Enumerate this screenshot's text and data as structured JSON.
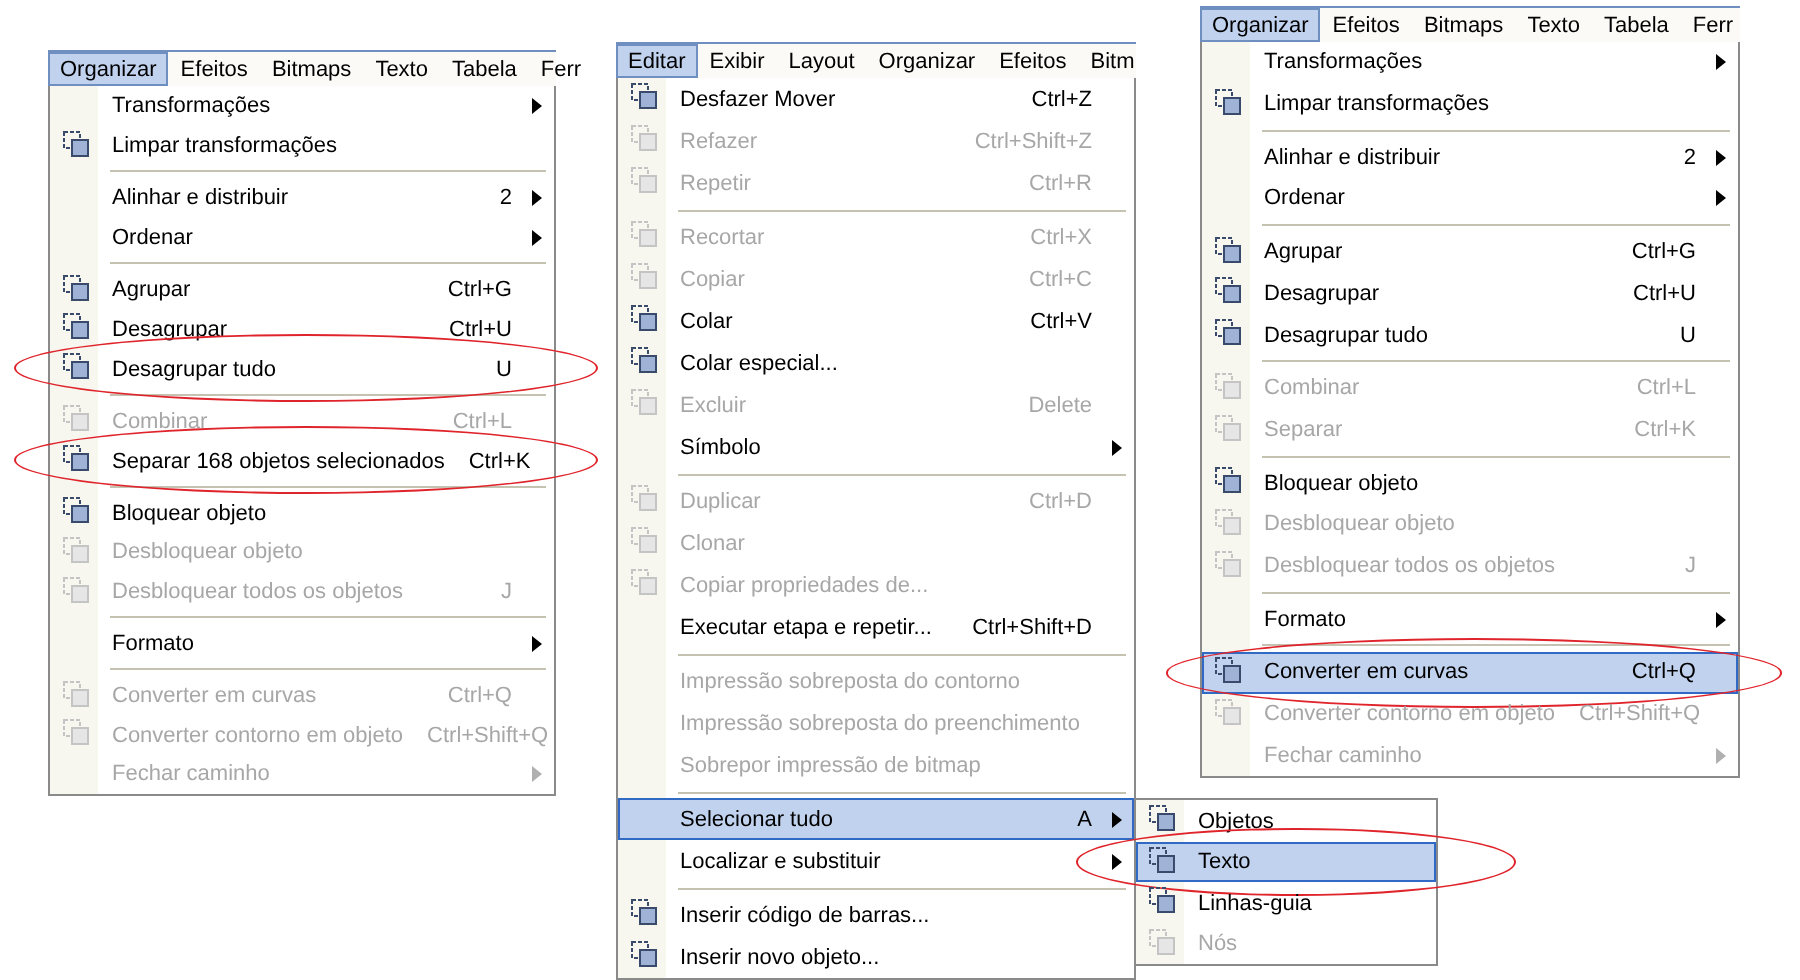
{
  "panels": [
    {
      "menubar": [
        {
          "label": "Organizar",
          "selected": true
        },
        {
          "label": "Efeitos",
          "selected": false
        },
        {
          "label": "Bitmaps",
          "selected": false
        },
        {
          "label": "Texto",
          "selected": false
        },
        {
          "label": "Tabela",
          "selected": false
        },
        {
          "label": "Ferr",
          "selected": false
        }
      ],
      "menu": [
        {
          "kind": "item",
          "label": "Transformações",
          "submenu": true,
          "disabled": false
        },
        {
          "kind": "item",
          "label": "Limpar transformações",
          "icon": true,
          "disabled": false
        },
        {
          "kind": "separator"
        },
        {
          "kind": "item",
          "label": "Alinhar e distribuir",
          "shortcut": "2",
          "submenu": true,
          "disabled": false
        },
        {
          "kind": "item",
          "label": "Ordenar",
          "submenu": true,
          "disabled": false
        },
        {
          "kind": "separator"
        },
        {
          "kind": "item",
          "label": "Agrupar",
          "shortcut": "Ctrl+G",
          "icon": true,
          "disabled": false
        },
        {
          "kind": "item",
          "label": "Desagrupar",
          "shortcut": "Ctrl+U",
          "icon": true,
          "disabled": false
        },
        {
          "kind": "item",
          "label": "Desagrupar tudo",
          "shortcut": "U",
          "icon": true,
          "disabled": false,
          "circled": true
        },
        {
          "kind": "separator"
        },
        {
          "kind": "item",
          "label": "Combinar",
          "shortcut": "Ctrl+L",
          "icon": true,
          "disabled": true
        },
        {
          "kind": "item",
          "label": "Separar 168 objetos selecionados",
          "shortcut": "Ctrl+K",
          "icon": true,
          "disabled": false,
          "circled": true
        },
        {
          "kind": "separator"
        },
        {
          "kind": "item",
          "label": "Bloquear objeto",
          "icon": true,
          "disabled": false
        },
        {
          "kind": "item",
          "label": "Desbloquear objeto",
          "icon": true,
          "disabled": true
        },
        {
          "kind": "item",
          "label": "Desbloquear todos os objetos",
          "shortcut": "J",
          "icon": true,
          "disabled": true
        },
        {
          "kind": "separator"
        },
        {
          "kind": "item",
          "label": "Formato",
          "submenu": true,
          "disabled": false
        },
        {
          "kind": "separator"
        },
        {
          "kind": "item",
          "label": "Converter em curvas",
          "shortcut": "Ctrl+Q",
          "icon": true,
          "disabled": true
        },
        {
          "kind": "item",
          "label": "Converter contorno em objeto",
          "shortcut": "Ctrl+Shift+Q",
          "icon": true,
          "disabled": true
        },
        {
          "kind": "item",
          "label": "Fechar caminho",
          "submenu": true,
          "disabled": true
        }
      ]
    },
    {
      "menubar": [
        {
          "label": "Editar",
          "selected": true
        },
        {
          "label": "Exibir",
          "selected": false
        },
        {
          "label": "Layout",
          "selected": false
        },
        {
          "label": "Organizar",
          "selected": false
        },
        {
          "label": "Efeitos",
          "selected": false
        },
        {
          "label": "Bitm",
          "selected": false
        }
      ],
      "menu": [
        {
          "kind": "item",
          "label": "Desfazer Mover",
          "shortcut": "Ctrl+Z",
          "icon": true,
          "disabled": false
        },
        {
          "kind": "item",
          "label": "Refazer",
          "shortcut": "Ctrl+Shift+Z",
          "icon": true,
          "disabled": true
        },
        {
          "kind": "item",
          "label": "Repetir",
          "shortcut": "Ctrl+R",
          "icon": true,
          "disabled": true
        },
        {
          "kind": "separator"
        },
        {
          "kind": "item",
          "label": "Recortar",
          "shortcut": "Ctrl+X",
          "icon": true,
          "disabled": true
        },
        {
          "kind": "item",
          "label": "Copiar",
          "shortcut": "Ctrl+C",
          "icon": true,
          "disabled": true
        },
        {
          "kind": "item",
          "label": "Colar",
          "shortcut": "Ctrl+V",
          "icon": true,
          "disabled": false
        },
        {
          "kind": "item",
          "label": "Colar especial...",
          "icon": true,
          "disabled": false
        },
        {
          "kind": "item",
          "label": "Excluir",
          "shortcut": "Delete",
          "icon": true,
          "disabled": true
        },
        {
          "kind": "item",
          "label": "Símbolo",
          "submenu": true,
          "disabled": false
        },
        {
          "kind": "separator"
        },
        {
          "kind": "item",
          "label": "Duplicar",
          "shortcut": "Ctrl+D",
          "icon": true,
          "disabled": true
        },
        {
          "kind": "item",
          "label": "Clonar",
          "icon": true,
          "disabled": true
        },
        {
          "kind": "item",
          "label": "Copiar propriedades de...",
          "icon": true,
          "disabled": true
        },
        {
          "kind": "item",
          "label": "Executar etapa e repetir...",
          "shortcut": "Ctrl+Shift+D",
          "disabled": false
        },
        {
          "kind": "separator"
        },
        {
          "kind": "item",
          "label": "Impressão sobreposta do contorno",
          "disabled": true
        },
        {
          "kind": "item",
          "label": "Impressão sobreposta do preenchimento",
          "disabled": true
        },
        {
          "kind": "item",
          "label": "Sobrepor impressão de bitmap",
          "disabled": true
        },
        {
          "kind": "separator"
        },
        {
          "kind": "item",
          "label": "Selecionar tudo",
          "shortcut": "A",
          "submenu": true,
          "disabled": false,
          "highlighted": true,
          "children": [
            {
              "label": "Objetos",
              "icon": true,
              "disabled": false,
              "highlighted": false
            },
            {
              "label": "Texto",
              "icon": true,
              "disabled": false,
              "highlighted": true,
              "circled": true
            },
            {
              "label": "Linhas-guia",
              "icon": true,
              "disabled": false,
              "highlighted": false
            },
            {
              "label": "Nós",
              "icon": true,
              "disabled": true,
              "highlighted": false
            }
          ]
        },
        {
          "kind": "item",
          "label": "Localizar e substituir",
          "submenu": true,
          "disabled": false
        },
        {
          "kind": "separator"
        },
        {
          "kind": "item",
          "label": "Inserir código de barras...",
          "icon": true,
          "disabled": false
        },
        {
          "kind": "item",
          "label": "Inserir novo objeto...",
          "icon": true,
          "disabled": false
        }
      ]
    },
    {
      "menubar": [
        {
          "label": "Organizar",
          "selected": true
        },
        {
          "label": "Efeitos",
          "selected": false
        },
        {
          "label": "Bitmaps",
          "selected": false
        },
        {
          "label": "Texto",
          "selected": false
        },
        {
          "label": "Tabela",
          "selected": false
        },
        {
          "label": "Ferr",
          "selected": false
        }
      ],
      "menu": [
        {
          "kind": "item",
          "label": "Transformações",
          "submenu": true,
          "disabled": false
        },
        {
          "kind": "item",
          "label": "Limpar transformações",
          "icon": true,
          "disabled": false
        },
        {
          "kind": "separator"
        },
        {
          "kind": "item",
          "label": "Alinhar e distribuir",
          "shortcut": "2",
          "submenu": true,
          "disabled": false
        },
        {
          "kind": "item",
          "label": "Ordenar",
          "submenu": true,
          "disabled": false
        },
        {
          "kind": "separator"
        },
        {
          "kind": "item",
          "label": "Agrupar",
          "shortcut": "Ctrl+G",
          "icon": true,
          "disabled": false
        },
        {
          "kind": "item",
          "label": "Desagrupar",
          "shortcut": "Ctrl+U",
          "icon": true,
          "disabled": false
        },
        {
          "kind": "item",
          "label": "Desagrupar tudo",
          "shortcut": "U",
          "icon": true,
          "disabled": false
        },
        {
          "kind": "separator"
        },
        {
          "kind": "item",
          "label": "Combinar",
          "shortcut": "Ctrl+L",
          "icon": true,
          "disabled": true
        },
        {
          "kind": "item",
          "label": "Separar",
          "shortcut": "Ctrl+K",
          "icon": true,
          "disabled": true
        },
        {
          "kind": "separator"
        },
        {
          "kind": "item",
          "label": "Bloquear objeto",
          "icon": true,
          "disabled": false
        },
        {
          "kind": "item",
          "label": "Desbloquear objeto",
          "icon": true,
          "disabled": true
        },
        {
          "kind": "item",
          "label": "Desbloquear todos os objetos",
          "shortcut": "J",
          "icon": true,
          "disabled": true
        },
        {
          "kind": "separator"
        },
        {
          "kind": "item",
          "label": "Formato",
          "submenu": true,
          "disabled": false
        },
        {
          "kind": "separator"
        },
        {
          "kind": "item",
          "label": "Converter em curvas",
          "shortcut": "Ctrl+Q",
          "icon": true,
          "disabled": false,
          "highlighted": true,
          "circled": true
        },
        {
          "kind": "item",
          "label": "Converter contorno em objeto",
          "shortcut": "Ctrl+Shift+Q",
          "icon": true,
          "disabled": true
        },
        {
          "kind": "item",
          "label": "Fechar caminho",
          "submenu": true,
          "disabled": true
        }
      ]
    }
  ]
}
